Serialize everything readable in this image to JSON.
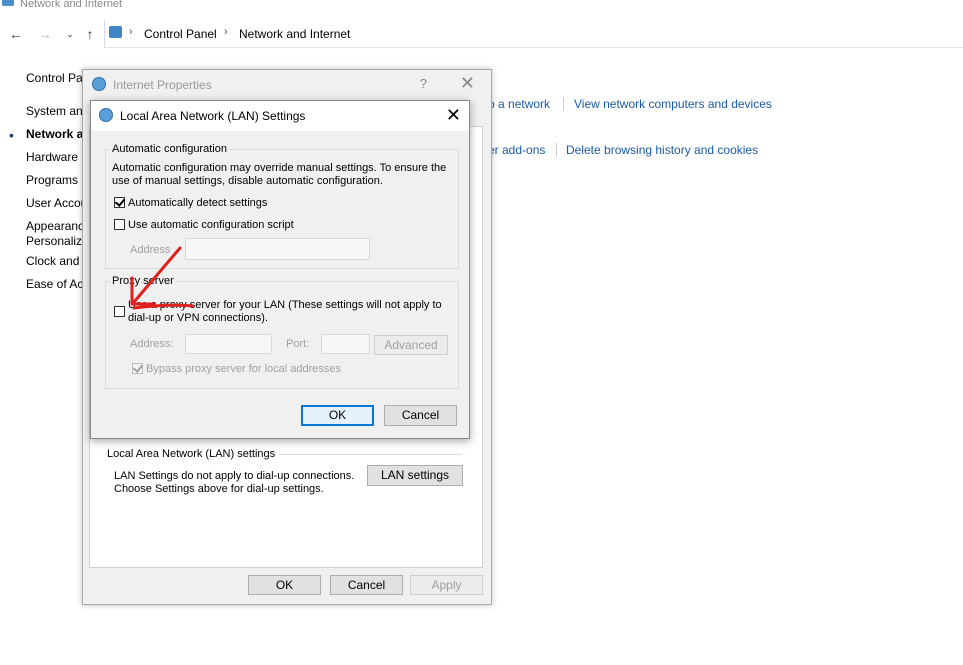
{
  "window": {
    "title": "Network and Internet"
  },
  "address_bar": {
    "crumbs": [
      "Control Panel",
      "Network and Internet"
    ]
  },
  "sidebar": {
    "items": [
      {
        "label": "Control Pa",
        "active": false
      },
      {
        "label": "System and",
        "active": false
      },
      {
        "label": "Network a",
        "active": true
      },
      {
        "label": "Hardware a",
        "active": false
      },
      {
        "label": "Programs",
        "active": false
      },
      {
        "label": "User Accou",
        "active": false
      },
      {
        "label": "Appearanc",
        "active": false
      },
      {
        "label": "Personaliza",
        "active": false
      },
      {
        "label": "Clock and",
        "active": false
      },
      {
        "label": "Ease of Acc",
        "active": false
      }
    ]
  },
  "main": {
    "links_row1": [
      "o a network",
      "View network computers and devices"
    ],
    "links_row2": [
      "er add-ons",
      "Delete browsing history and cookies"
    ]
  },
  "internet_properties": {
    "title": "Internet Properties",
    "help": "?",
    "close": "✕",
    "lan_section": {
      "label": "Local Area Network (LAN) settings",
      "desc_line1": "LAN Settings do not apply to dial-up connections.",
      "desc_line2": "Choose Settings above for dial-up settings.",
      "button": "LAN settings"
    },
    "buttons": {
      "ok": "OK",
      "cancel": "Cancel",
      "apply": "Apply"
    }
  },
  "lan_dialog": {
    "title": "Local Area Network (LAN) Settings",
    "close": "✕",
    "auto_config": {
      "label": "Automatic configuration",
      "desc_line1": "Automatic configuration may override manual settings.  To ensure the",
      "desc_line2": "use of manual settings, disable automatic configuration.",
      "detect_label": "Automatically detect settings",
      "detect_checked": true,
      "script_label": "Use automatic configuration script",
      "script_checked": false,
      "address_label": "Address",
      "address_value": ""
    },
    "proxy": {
      "label": "Proxy server",
      "use_label_line1": "Use a proxy server for your LAN (These settings will not apply to",
      "use_label_line2": "dial-up or VPN connections).",
      "use_checked": false,
      "address_label": "Address:",
      "address_value": "",
      "port_label": "Port:",
      "port_value": "",
      "advanced": "Advanced",
      "bypass_label": "Bypass proxy server for local addresses",
      "bypass_checked": true
    },
    "buttons": {
      "ok": "OK",
      "cancel": "Cancel"
    }
  },
  "colors": {
    "link": "#1a5aa6",
    "annotation": "#e0201c",
    "focus": "#0078d7"
  }
}
